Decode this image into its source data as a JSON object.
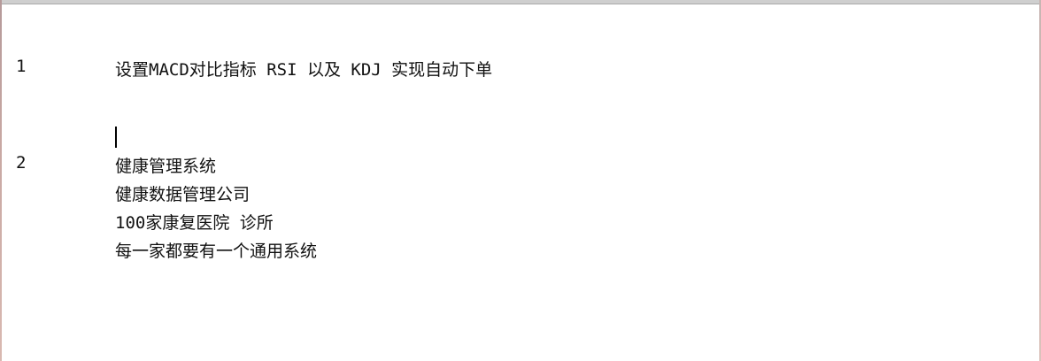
{
  "editor": {
    "entries": [
      {
        "number": "1",
        "lines": [
          "设置MACD对比指标 RSI 以及 KDJ 实现自动下单"
        ]
      },
      {
        "number": "2",
        "lines": [
          "健康管理系统",
          "健康数据管理公司",
          "100家康复医院 诊所",
          "每一家都要有一个通用系统"
        ]
      }
    ]
  }
}
